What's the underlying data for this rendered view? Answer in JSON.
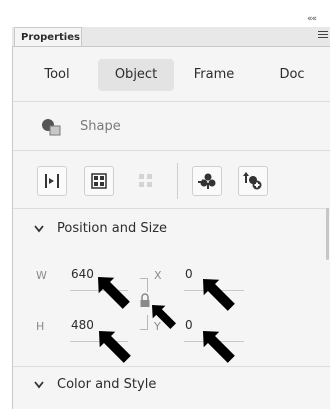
{
  "panel": {
    "tab_label": "Properties",
    "collapse_glyph": "««"
  },
  "modes": [
    "Tool",
    "Object",
    "Frame",
    "Doc"
  ],
  "active_mode": "Object",
  "shape": {
    "label": "Shape",
    "icon": "shape-icon"
  },
  "toolbar": {
    "buttons": [
      "align-left-icon",
      "grid-icon",
      "distribute-icon-disabled",
      "transform-icon",
      "add-symbol-icon"
    ]
  },
  "position_size": {
    "title": "Position and Size",
    "w_label": "W",
    "w_value": "640",
    "h_label": "H",
    "h_value": "480",
    "x_label": "X",
    "x_value": "0",
    "y_label": "Y",
    "y_value": "0",
    "lock_icon": "lock-icon"
  },
  "color_style": {
    "title": "Color and Style"
  },
  "colors": {
    "panel_bg": "#f5f5f5",
    "active_tab": "#e3e3e3",
    "arrow": "#000000"
  }
}
